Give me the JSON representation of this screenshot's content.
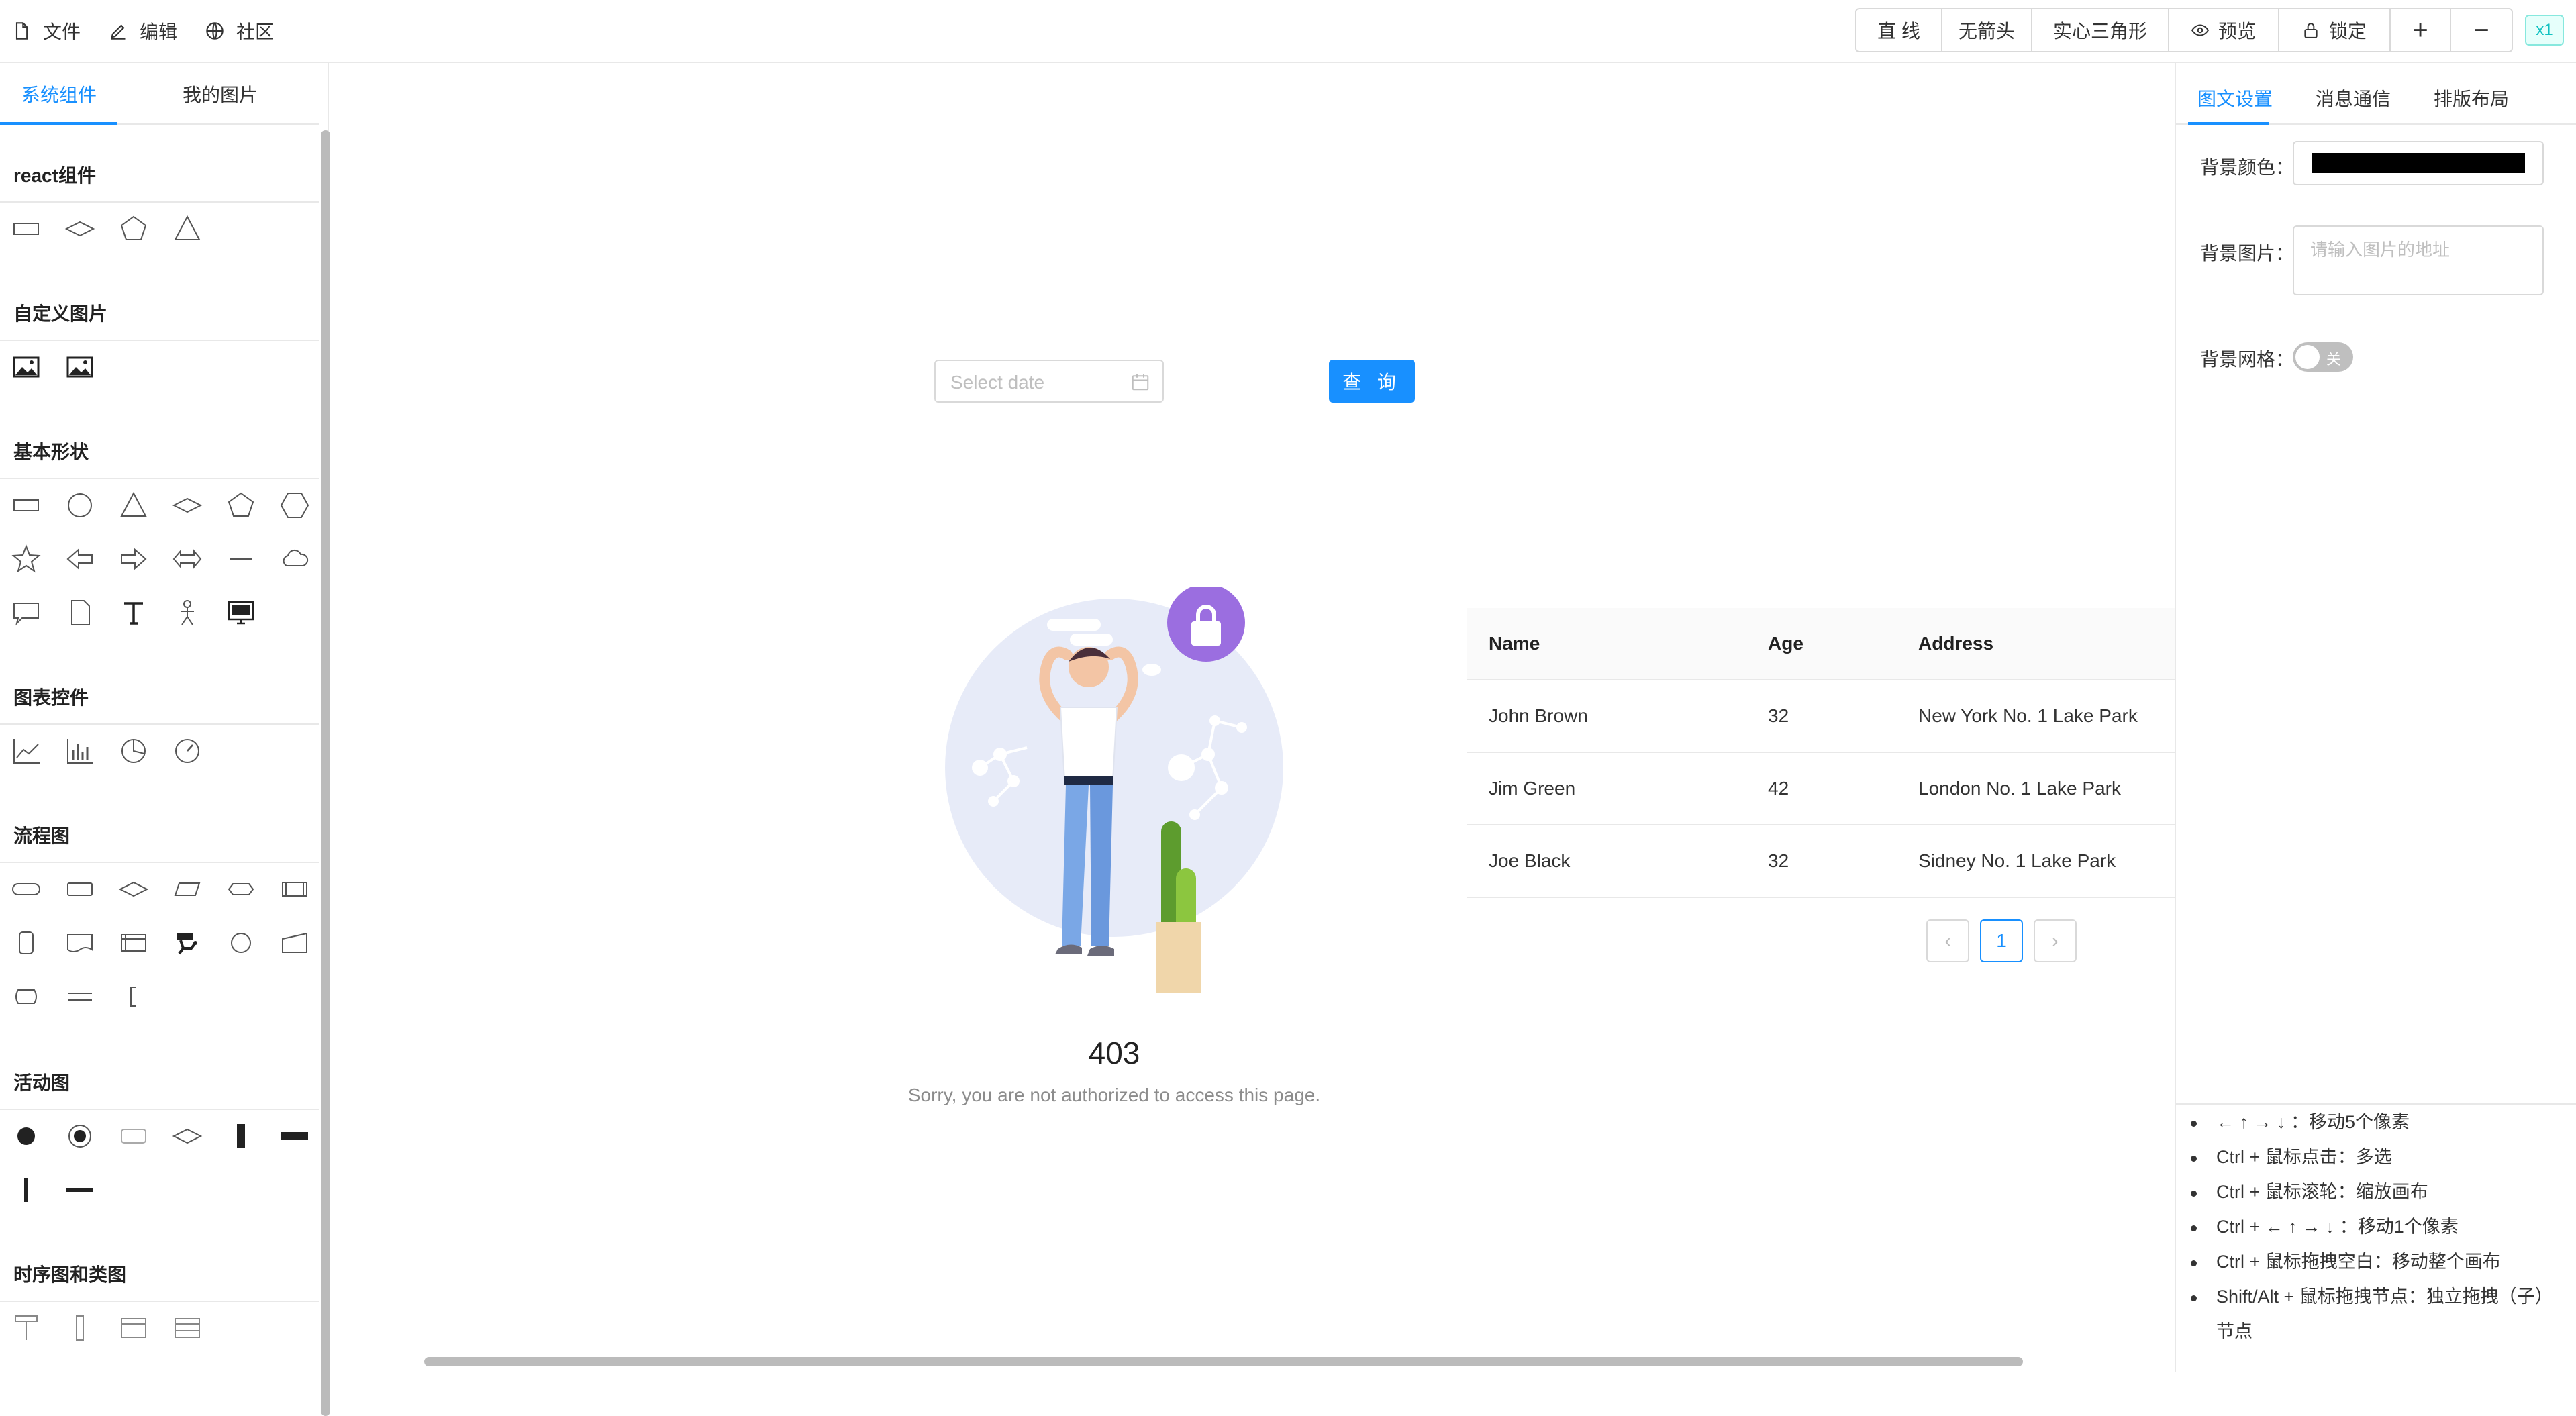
{
  "menu": {
    "file": "文件",
    "edit": "编辑",
    "community": "社区"
  },
  "toolbar": {
    "line": "直 线",
    "no_arrow": "无箭头",
    "solid_triangle": "实心三角形",
    "preview": "预览",
    "lock": "锁定",
    "zoom_in": "+",
    "zoom_out": "−",
    "zoom_level": "x1"
  },
  "left": {
    "tabs": [
      "系统组件",
      "我的图片"
    ],
    "sections": {
      "react": "react组件",
      "custom_image": "自定义图片",
      "basic_shapes": "基本形状",
      "chart_controls": "图表控件",
      "flowchart": "流程图",
      "activity": "活动图",
      "sequence_class": "时序图和类图"
    }
  },
  "canvas": {
    "date_placeholder": "Select date",
    "query_button": "查 询",
    "result_code": "403",
    "result_message": "Sorry, you are not authorized to access this page.",
    "table": {
      "headers": [
        "Name",
        "Age",
        "Address"
      ],
      "rows": [
        [
          "John Brown",
          "32",
          "New York No. 1 Lake Park"
        ],
        [
          "Jim Green",
          "42",
          "London No. 1 Lake Park"
        ],
        [
          "Joe Black",
          "32",
          "Sidney No. 1 Lake Park"
        ]
      ]
    },
    "pagination": {
      "prev": "‹",
      "current": "1",
      "next": "›"
    }
  },
  "right": {
    "tabs": [
      "图文设置",
      "消息通信",
      "排版布局"
    ],
    "bg_color_label": "背景颜色：",
    "bg_color": "#000000",
    "bg_image_label": "背景图片：",
    "bg_image_placeholder": "请输入图片的地址",
    "bg_grid_label": "背景网格：",
    "bg_grid_state": "关",
    "tips": [
      "← ↑ → ↓ ：移动5个像素",
      "Ctrl + 鼠标点击：多选",
      "Ctrl + 鼠标滚轮：缩放画布",
      "Ctrl + ← ↑ → ↓ ：移动1个像素",
      "Ctrl + 鼠标拖拽空白：移动整个画布",
      "Shift/Alt + 鼠标拖拽节点：独立拖拽（子）节点"
    ]
  },
  "colors": {
    "accent": "#1890ff",
    "purple": "#9b6ee0"
  }
}
